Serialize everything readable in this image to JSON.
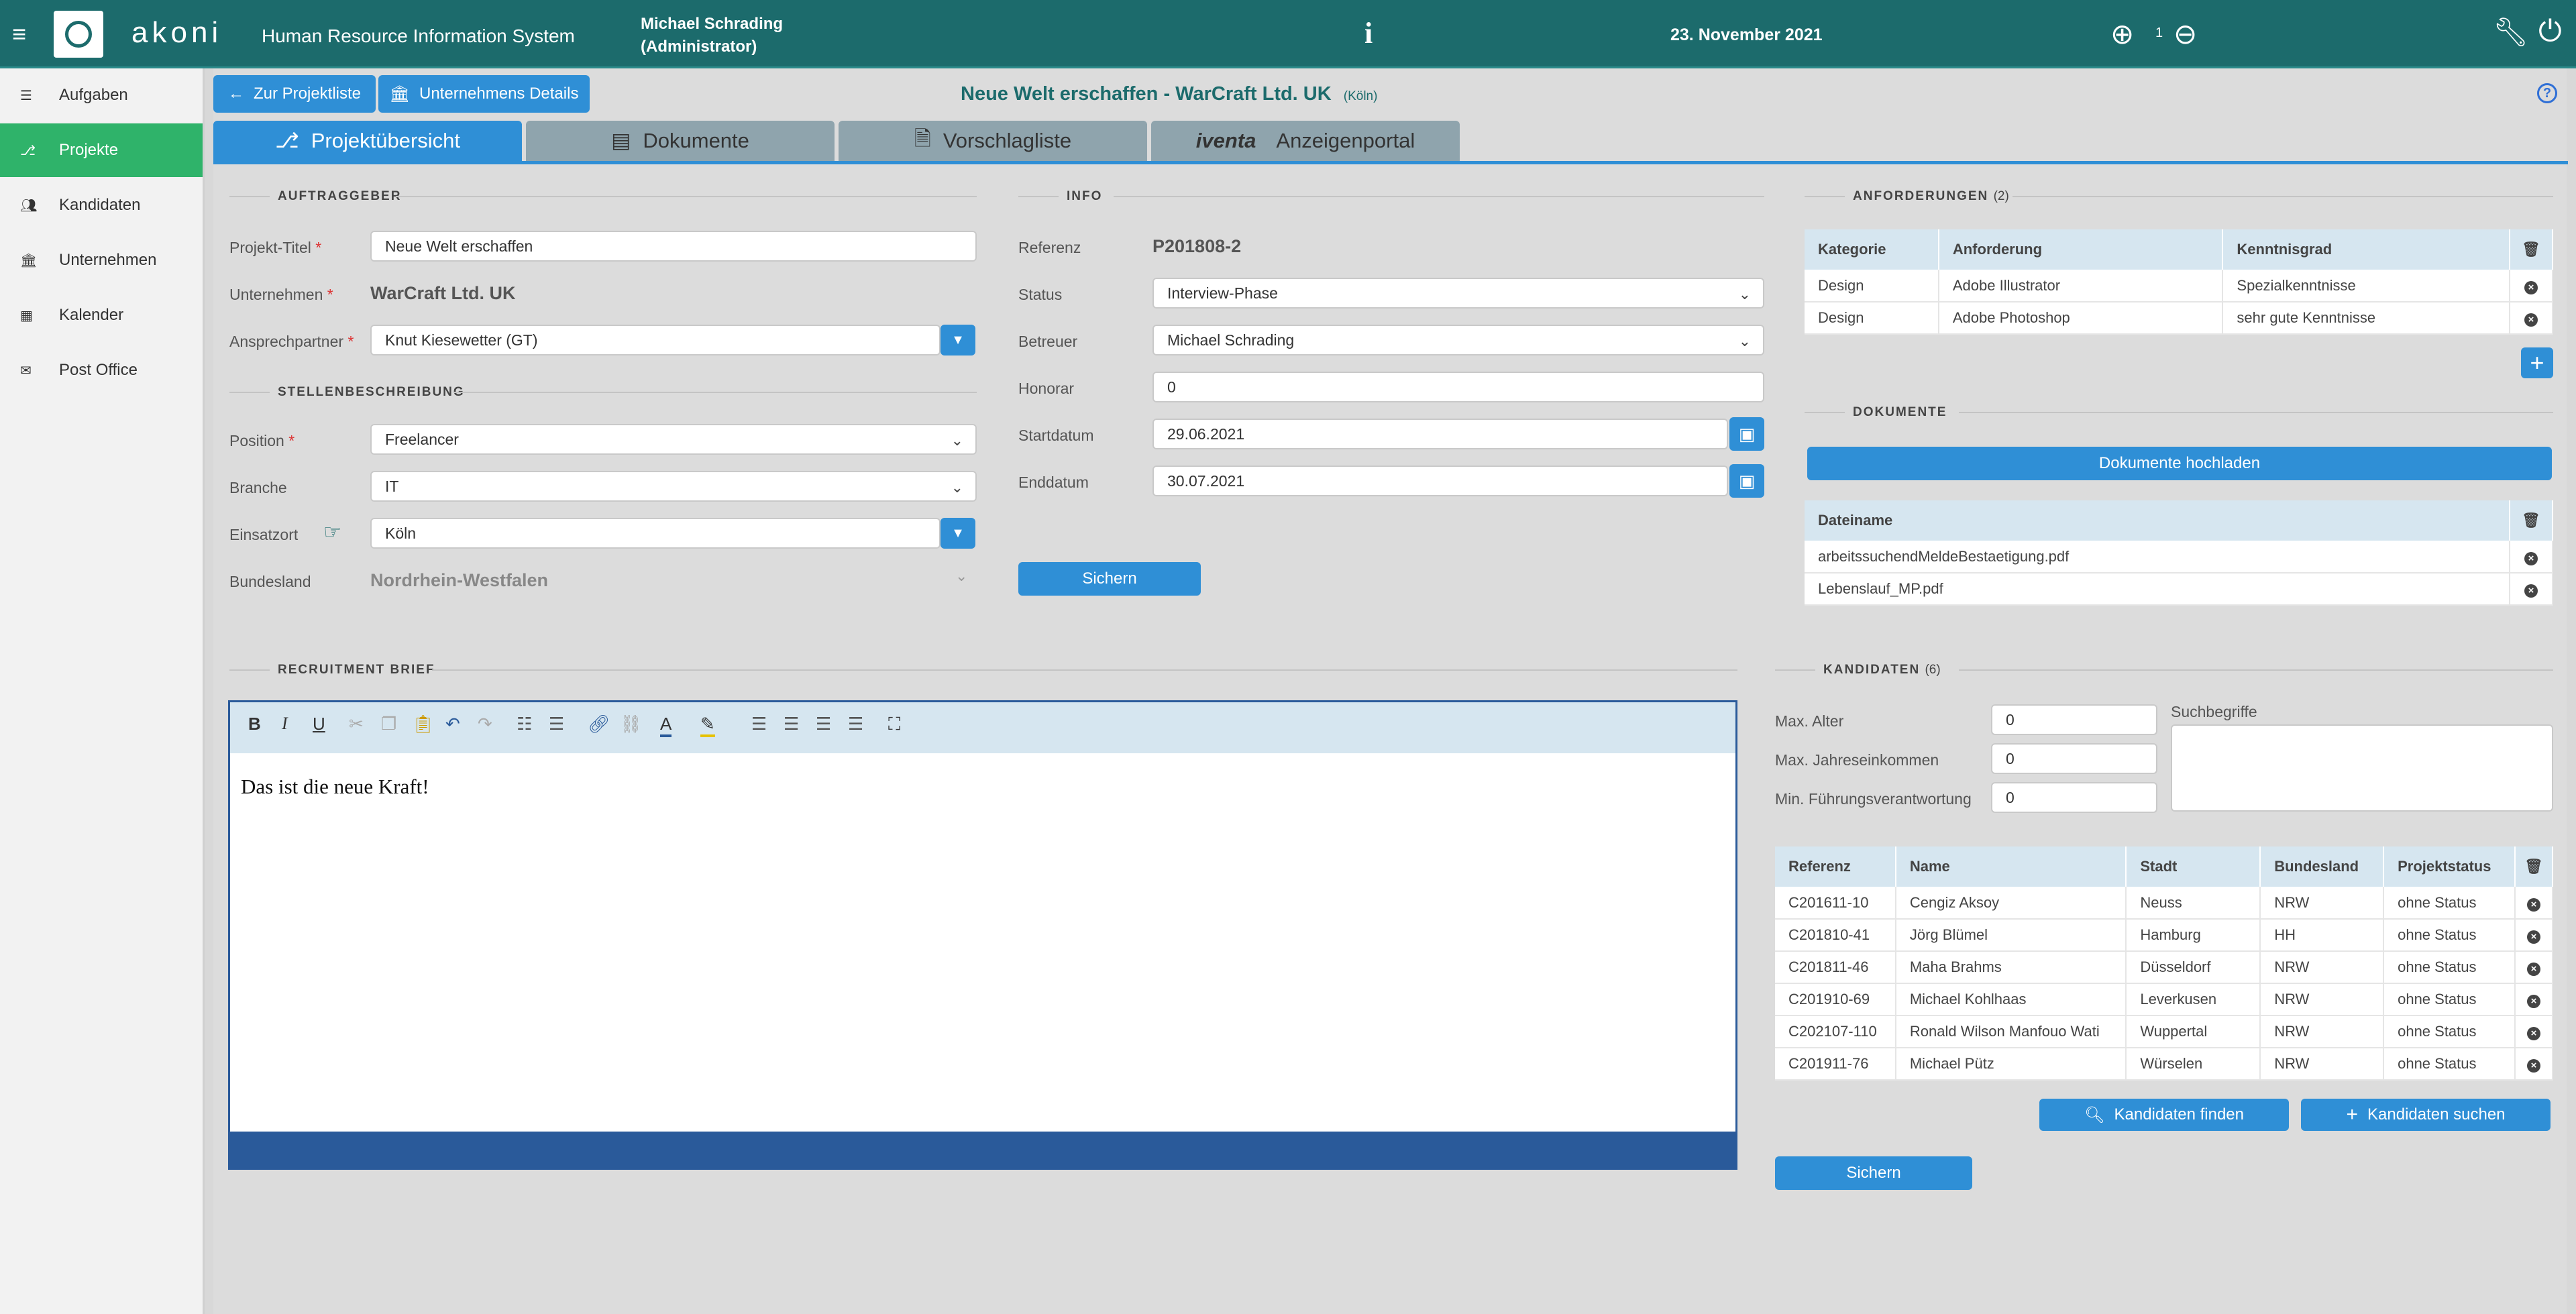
{
  "header": {
    "app_name": "akoni",
    "subtitle": "Human Resource Information System",
    "user_name": "Michael Schrading",
    "user_role": "(Administrator)",
    "info_icon": "info-icon",
    "date": "23. November 2021",
    "zoom_level": "1",
    "accent": "#1c6b6c"
  },
  "sidebar": {
    "items": [
      {
        "label": "Aufgaben",
        "icon": "list-icon"
      },
      {
        "label": "Projekte",
        "icon": "project-icon"
      },
      {
        "label": "Kandidaten",
        "icon": "users-icon"
      },
      {
        "label": "Unternehmen",
        "icon": "bank-icon"
      },
      {
        "label": "Kalender",
        "icon": "calendar-icon"
      },
      {
        "label": "Post Office",
        "icon": "mail-icon"
      }
    ],
    "active_color": "#2fb36a"
  },
  "toolbar": {
    "back_label": "Zur Projektliste",
    "company_details_label": "Unternehmens Details"
  },
  "page": {
    "title": "Neue Welt erschaffen - WarCraft Ltd. UK",
    "location": "(Köln)"
  },
  "tabs": [
    {
      "label": "Projektübersicht",
      "active": true
    },
    {
      "label": "Dokumente",
      "active": false
    },
    {
      "label": "Vorschlagliste",
      "active": false
    },
    {
      "label": "Anzeigenportal",
      "brand": "iventa",
      "active": false
    }
  ],
  "auftraggeber": {
    "section_title": "AUFTRAGGEBER",
    "projekt_titel_label": "Projekt-Titel",
    "projekt_titel_value": "Neue Welt erschaffen",
    "unternehmen_label": "Unternehmen",
    "unternehmen_value": "WarCraft Ltd. UK",
    "ansprechpartner_label": "Ansprechpartner",
    "ansprechpartner_value": "Knut Kiesewetter (GT)",
    "required_mark": "*"
  },
  "stellenbeschreibung": {
    "section_title": "STELLENBESCHREIBUNG",
    "position_label": "Position",
    "position_value": "Freelancer",
    "branche_label": "Branche",
    "branche_value": "IT",
    "einsatzort_label": "Einsatzort",
    "einsatzort_value": "Köln",
    "bundesland_label": "Bundesland",
    "bundesland_value": "Nordrhein-Westfalen"
  },
  "info": {
    "section_title": "INFO",
    "referenz_label": "Referenz",
    "referenz_value": "P201808-2",
    "status_label": "Status",
    "status_value": "Interview-Phase",
    "betreuer_label": "Betreuer",
    "betreuer_value": "Michael Schrading",
    "honorar_label": "Honorar",
    "honorar_value": "0",
    "startdatum_label": "Startdatum",
    "startdatum_value": "29.06.2021",
    "enddatum_label": "Enddatum",
    "enddatum_value": "30.07.2021",
    "save_label": "Sichern"
  },
  "anforderungen": {
    "section_title": "ANFORDERUNGEN",
    "count": "(2)",
    "columns": [
      "Kategorie",
      "Anforderung",
      "Kenntnisgrad"
    ],
    "rows": [
      [
        "Design",
        "Adobe Illustrator",
        "Spezialkenntnisse"
      ],
      [
        "Design",
        "Adobe Photoshop",
        "sehr gute Kenntnisse"
      ]
    ]
  },
  "dokumente": {
    "section_title": "DOKUMENTE",
    "upload_label": "Dokumente hochladen",
    "column": "Dateiname",
    "files": [
      "arbeitssuchendMeldeBestaetigung.pdf",
      "Lebenslauf_MP.pdf"
    ]
  },
  "recruitment_brief": {
    "section_title": "RECRUITMENT BRIEF",
    "content": "Das ist die neue Kraft!"
  },
  "kandidaten": {
    "section_title": "KANDIDATEN",
    "count": "(6)",
    "max_alter_label": "Max. Alter",
    "max_alter_value": "0",
    "max_einkommen_label": "Max. Jahreseinkommen",
    "max_einkommen_value": "0",
    "min_fuehrung_label": "Min. Führungsverantwortung",
    "min_fuehrung_value": "0",
    "suchbegriffe_label": "Suchbegriffe",
    "columns": [
      "Referenz",
      "Name",
      "Stadt",
      "Bundesland",
      "Projektstatus"
    ],
    "rows": [
      [
        "C201611-10",
        "Cengiz Aksoy",
        "Neuss",
        "NRW",
        "ohne Status"
      ],
      [
        "C201810-41",
        "Jörg Blümel",
        "Hamburg",
        "HH",
        "ohne Status"
      ],
      [
        "C201811-46",
        "Maha Brahms",
        "Düsseldorf",
        "NRW",
        "ohne Status"
      ],
      [
        "C201910-69",
        "Michael Kohlhaas",
        "Leverkusen",
        "NRW",
        "ohne Status"
      ],
      [
        "C202107-110",
        "Ronald Wilson Manfouo Wati",
        "Wuppertal",
        "NRW",
        "ohne Status"
      ],
      [
        "C201911-76",
        "Michael Pütz",
        "Würselen",
        "NRW",
        "ohne Status"
      ]
    ],
    "find_label": "Kandidaten finden",
    "search_label": "Kandidaten suchen",
    "save_label": "Sichern"
  }
}
